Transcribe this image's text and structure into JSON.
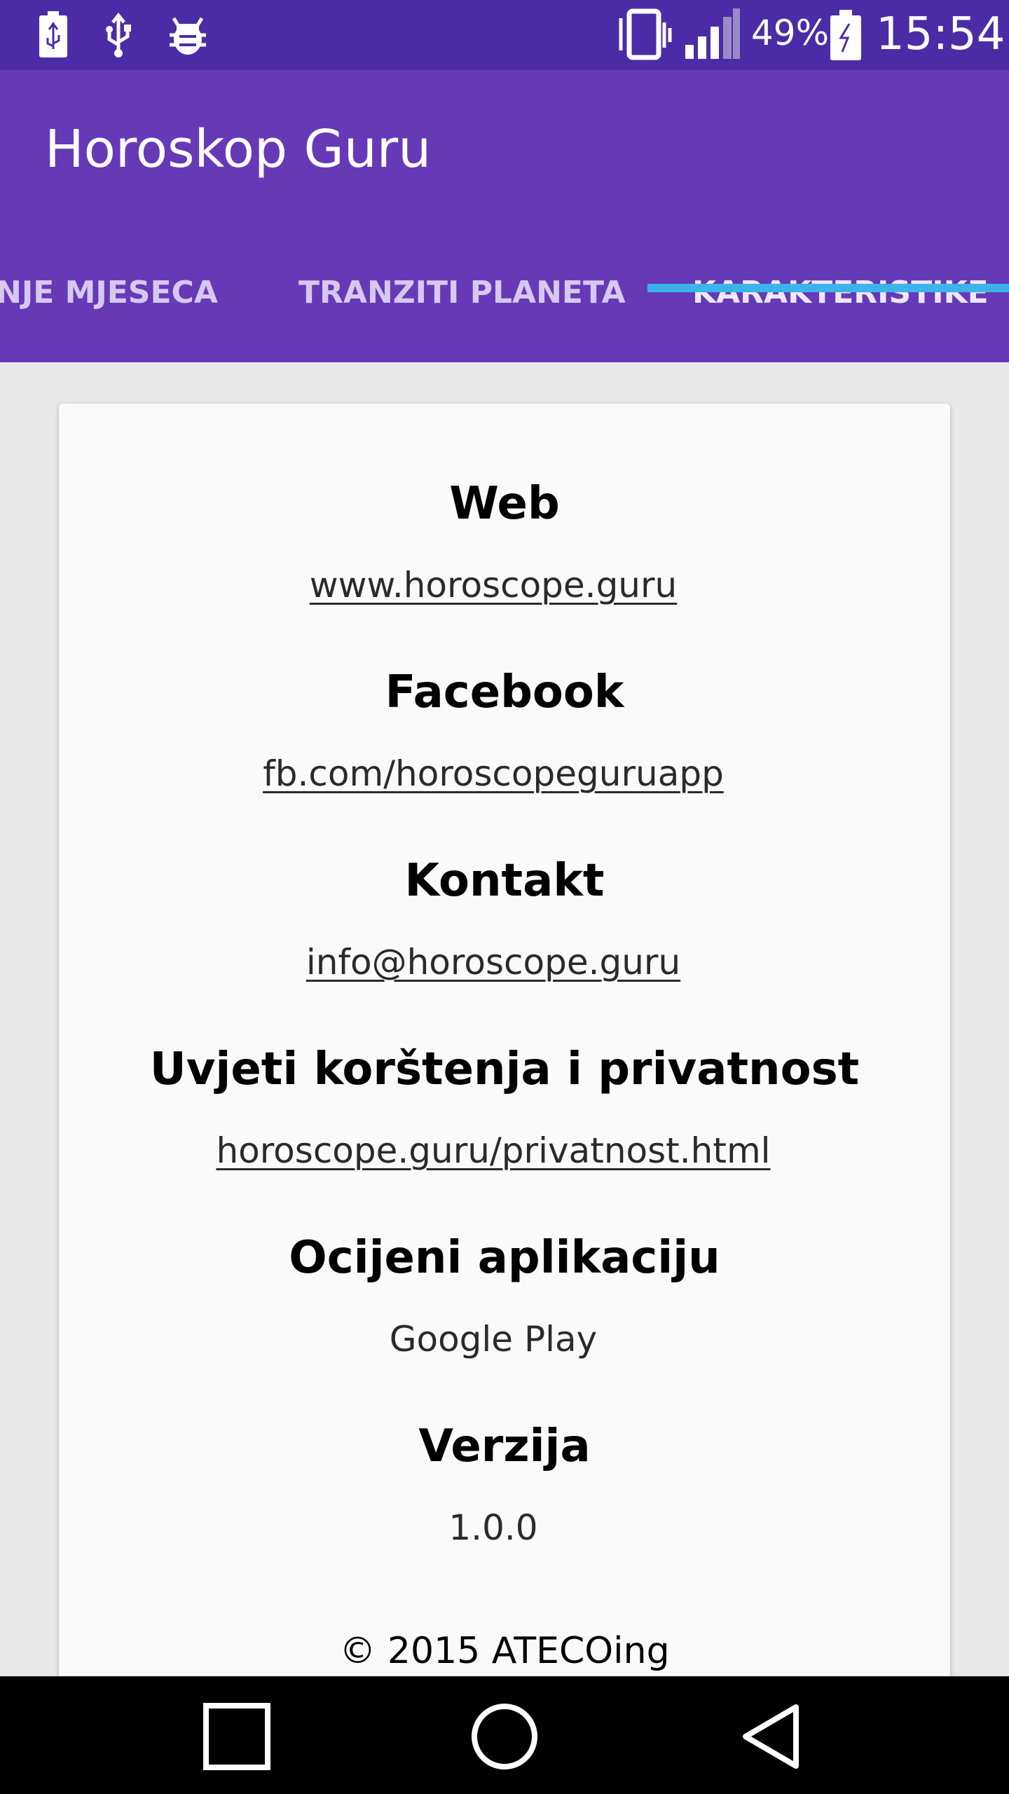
{
  "status_bar": {
    "battery_percent": "49%",
    "time": "15:54",
    "icons": [
      "usb-battery-icon",
      "usb-icon",
      "bug-icon",
      "vibrate-icon",
      "signal-icon",
      "battery-icon"
    ]
  },
  "app": {
    "title": "Horoskop Guru"
  },
  "tabs": [
    {
      "label": "NJE MJESECA",
      "active": false
    },
    {
      "label": "TRANZITI PLANETA",
      "active": false
    },
    {
      "label": "KARAKTERISTIKE",
      "active": true
    }
  ],
  "colors": {
    "status_bar": "#4b2ca6",
    "app_bar": "#663ab7",
    "tab_indicator": "#3ab4ea",
    "card_bg": "#fafafa"
  },
  "sections": [
    {
      "title": "Web",
      "value": "www.horoscope.guru",
      "is_link": true
    },
    {
      "title": "Facebook",
      "value": "fb.com/horoscopeguruapp",
      "is_link": true
    },
    {
      "title": "Kontakt",
      "value": "info@horoscope.guru",
      "is_link": true
    },
    {
      "title": "Uvjeti korštenja i privatnost",
      "value": "horoscope.guru/privatnost.html",
      "is_link": true
    },
    {
      "title": "Ocijeni aplikaciju",
      "value": "Google Play",
      "is_link": false
    },
    {
      "title": "Verzija",
      "value": "1.0.0",
      "is_link": false
    }
  ],
  "copyright": "© 2015 ATECOing",
  "nav_bar": {
    "buttons": [
      "recent-apps-icon",
      "home-icon",
      "back-icon"
    ]
  }
}
